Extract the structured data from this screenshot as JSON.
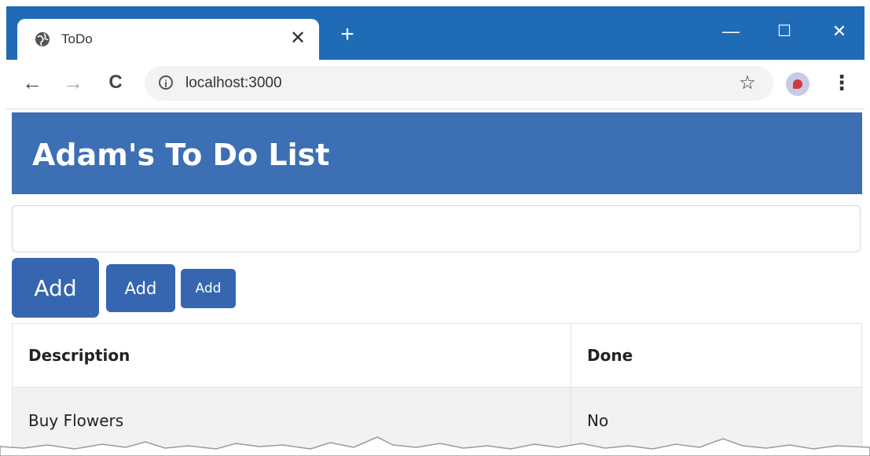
{
  "browser": {
    "tab_title": "ToDo",
    "tab_close": "✕",
    "new_tab": "+",
    "url": "localhost:3000",
    "controls": {
      "minimize": "—",
      "maximize": "☐",
      "close": "✕"
    },
    "icons": [
      "globe-icon",
      "back-icon",
      "forward-icon",
      "reload-icon",
      "info-icon",
      "star-icon",
      "avatar",
      "menu-icon"
    ],
    "nav": {
      "back": "←",
      "forward": "→",
      "reload": "C",
      "star": "☆",
      "menu": "⋮",
      "info": "i"
    }
  },
  "page": {
    "title": "Adam's To Do List",
    "input": {
      "value": "",
      "placeholder": ""
    },
    "buttons": {
      "large": "Add",
      "medium": "Add",
      "small": "Add"
    },
    "table": {
      "headers": [
        "Description",
        "Done"
      ],
      "rows": [
        [
          "Buy Flowers",
          "No"
        ]
      ]
    }
  },
  "colors": {
    "titlebar": "#1f6bb5",
    "banner": "#3c6fb3",
    "button": "#3666b0",
    "row_stripe": "#f2f2f2"
  }
}
